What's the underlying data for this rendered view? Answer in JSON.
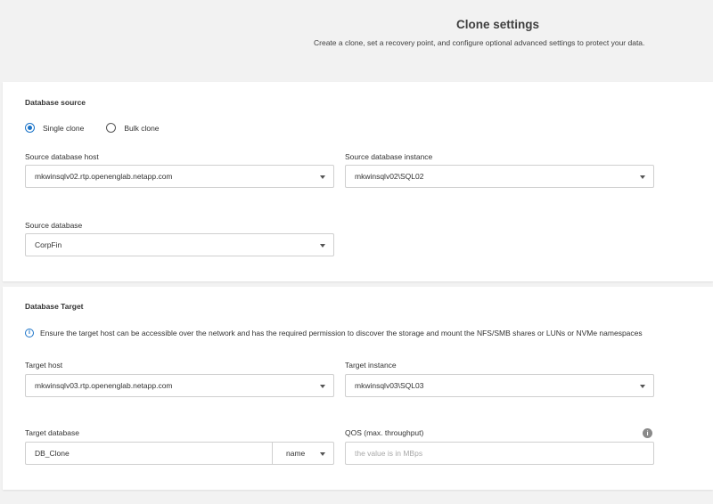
{
  "header": {
    "title": "Clone settings",
    "subtitle": "Create a clone, set a recovery point, and configure optional advanced settings to protect your data."
  },
  "source": {
    "section_title": "Database source",
    "clone_mode": {
      "options": [
        "Single clone",
        "Bulk clone"
      ],
      "selected": "Single clone"
    },
    "host_label": "Source database host",
    "host_value": "mkwinsqlv02.rtp.openenglab.netapp.com",
    "instance_label": "Source database instance",
    "instance_value": "mkwinsqlv02\\SQL02",
    "database_label": "Source database",
    "database_value": "CorpFin"
  },
  "target": {
    "section_title": "Database Target",
    "info_text": "Ensure the target host can be accessible over the network and has the required permission to discover the storage and mount the NFS/SMB shares or LUNs or NVMe namespaces",
    "host_label": "Target host",
    "host_value": "mkwinsqlv03.rtp.openenglab.netapp.com",
    "instance_label": "Target instance",
    "instance_value": "mkwinsqlv03\\SQL03",
    "database_label": "Target database",
    "database_value": "DB_Clone",
    "database_suffix_value": "name",
    "qos_label": "QOS (max. throughput)",
    "qos_placeholder": "the value is in MBps"
  },
  "colors": {
    "accent": "#1a73c8",
    "background": "#f2f2f2",
    "card": "#ffffff"
  }
}
